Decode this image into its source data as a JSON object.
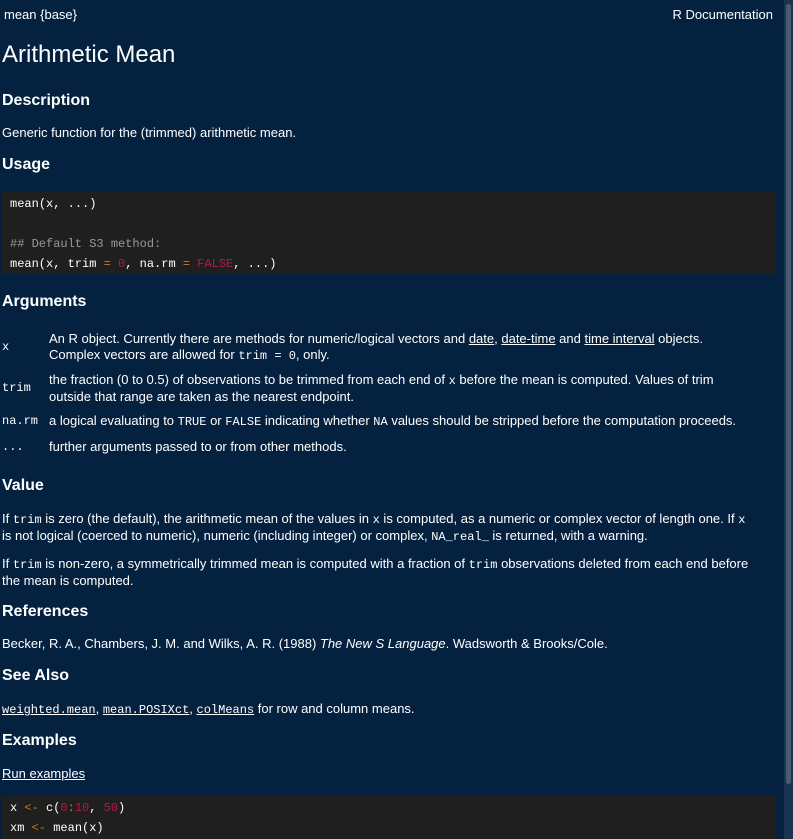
{
  "header": {
    "left": "mean {base}",
    "right": "R Documentation"
  },
  "title": "Arithmetic Mean",
  "description": {
    "heading": "Description",
    "text": "Generic function for the (trimmed) arithmetic mean."
  },
  "usage": {
    "heading": "Usage",
    "l1_fn": "mean",
    "l1_args": "(x, ...)",
    "comment": "## Default S3 method:",
    "l3_a": "mean(x, trim ",
    "l3_eq1": "=",
    "l3_zero": "0",
    "l3_b": ", na.rm ",
    "l3_eq2": "=",
    "l3_false": "FALSE",
    "l3_c": ", ...)"
  },
  "arguments": {
    "heading": "Arguments",
    "x": {
      "name": "x",
      "t1": "An R object. Currently there are methods for numeric/logical vectors and ",
      "link1": "date",
      "t2": ", ",
      "link2": "date-time",
      "t3": " and ",
      "link3": "time interval",
      "t4": " objects.",
      "t5": "Complex vectors are allowed for ",
      "code": "trim = 0",
      "t6": ", only."
    },
    "trim": {
      "name": "trim",
      "t1": "the fraction (0 to 0.5) of observations to be trimmed from each end of ",
      "code": "x",
      "t2": " before the mean is computed. Values of trim",
      "t3": "outside that range are taken as the nearest endpoint."
    },
    "narm": {
      "name": "na.rm",
      "t1": "a logical evaluating to ",
      "c1": "TRUE",
      "t2": " or ",
      "c2": "FALSE",
      "t3": " indicating whether ",
      "c3": "NA",
      "t4": " values should be stripped before the computation proceeds."
    },
    "dots": {
      "name": "...",
      "text": "further arguments passed to or from other methods."
    }
  },
  "value": {
    "heading": "Value",
    "p1_a": "If ",
    "p1_c1": "trim",
    "p1_b": " is zero (the default), the arithmetic mean of the values in ",
    "p1_c2": "x",
    "p1_c": " is computed, as a numeric or complex vector of length one. If ",
    "p1_c3": "x",
    "p1_d": "is not logical (coerced to numeric), numeric (including integer) or complex, ",
    "p1_c4": "NA_real_",
    "p1_e": " is returned, with a warning.",
    "p2_a": "If ",
    "p2_c1": "trim",
    "p2_b": " is non-zero, a symmetrically trimmed mean is computed with a fraction of ",
    "p2_c2": "trim",
    "p2_c": " observations deleted from each end before",
    "p2_d": "the mean is computed."
  },
  "references": {
    "heading": "References",
    "a": "Becker, R. A., Chambers, J. M. and Wilks, A. R. (1988) ",
    "book": "The New S Language",
    "b": ". Wadsworth & Brooks/Cole."
  },
  "see_also": {
    "heading": "See Also",
    "l1": "weighted.mean",
    "s1": ", ",
    "l2": "mean.POSIXct",
    "s2": ", ",
    "l3": "colMeans",
    "t": " for row and column means."
  },
  "examples": {
    "heading": "Examples",
    "run_link": "Run examples",
    "e1_a": "x ",
    "e1_op": "<-",
    "e1_b": " c(",
    "e1_n1": "0",
    "e1_colon": ":",
    "e1_n2": "10",
    "e1_c": ", ",
    "e1_n3": "50",
    "e1_d": ")",
    "e2_a": "xm ",
    "e2_op": "<-",
    "e2_b": " mean(x)"
  }
}
